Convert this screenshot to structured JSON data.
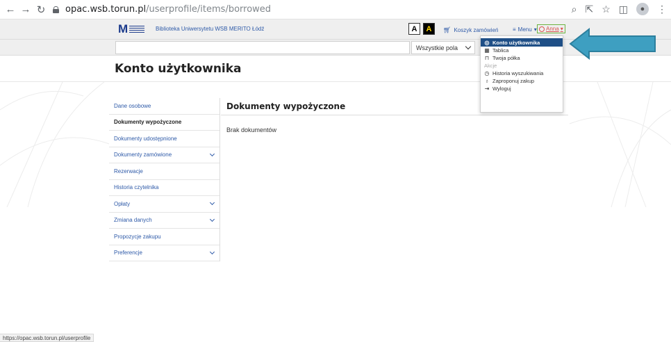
{
  "browser": {
    "url_host": "opac.wsb.torun.pl",
    "url_path": "/userprofile/items/borrowed",
    "back_icon": "arrow-left-icon",
    "forward_icon": "arrow-right-icon",
    "reload_icon": "reload-icon"
  },
  "header": {
    "library_name": "Biblioteka Uniwersytetu WSB MERITO Łódź",
    "contrast_a": "A",
    "contrast_b": "A",
    "cart_label": "Koszyk zamówień",
    "menu_label": "Menu",
    "user_label": "Anna"
  },
  "search": {
    "query": "",
    "field_selected": "Wszystkie pola"
  },
  "page": {
    "title": "Konto użytkownika"
  },
  "sidebar": {
    "items": [
      {
        "label": "Dane osobowe",
        "active": false,
        "expandable": false
      },
      {
        "label": "Dokumenty wypożyczone",
        "active": true,
        "expandable": false
      },
      {
        "label": "Dokumenty udostępnione",
        "active": false,
        "expandable": false
      },
      {
        "label": "Dokumenty zamówione",
        "active": false,
        "expandable": true
      },
      {
        "label": "Rezerwacje",
        "active": false,
        "expandable": false
      },
      {
        "label": "Historia czytelnika",
        "active": false,
        "expandable": false
      },
      {
        "label": "Opłaty",
        "active": false,
        "expandable": true
      },
      {
        "label": "Zmiana danych",
        "active": false,
        "expandable": true
      },
      {
        "label": "Propozycje zakupu",
        "active": false,
        "expandable": false
      },
      {
        "label": "Preferencje",
        "active": false,
        "expandable": true
      }
    ]
  },
  "content": {
    "title": "Dokumenty wypożyczone",
    "empty_text": "Brak dokumentów"
  },
  "dropdown": {
    "items": [
      {
        "label": "Konto użytkownika",
        "icon": "user-circle-icon"
      },
      {
        "label": "Tablica",
        "icon": "table-icon"
      },
      {
        "label": "Twoja półka",
        "icon": "bookmark-icon"
      }
    ],
    "section_header": "Akcje",
    "actions": [
      {
        "label": "Historia wyszukiwania",
        "icon": "clock-icon"
      },
      {
        "label": "Zaproponuj zakup",
        "icon": "lightbulb-icon"
      },
      {
        "label": "Wyloguj",
        "icon": "logout-icon"
      }
    ]
  },
  "status_bar": {
    "text": "https://opac.wsb.torun.pl/userprofile"
  },
  "colors": {
    "link": "#2e5aa8",
    "dropdown_active": "#1f4f86",
    "arrow": "#3e9fc1",
    "user_badge": "#d9534f"
  }
}
